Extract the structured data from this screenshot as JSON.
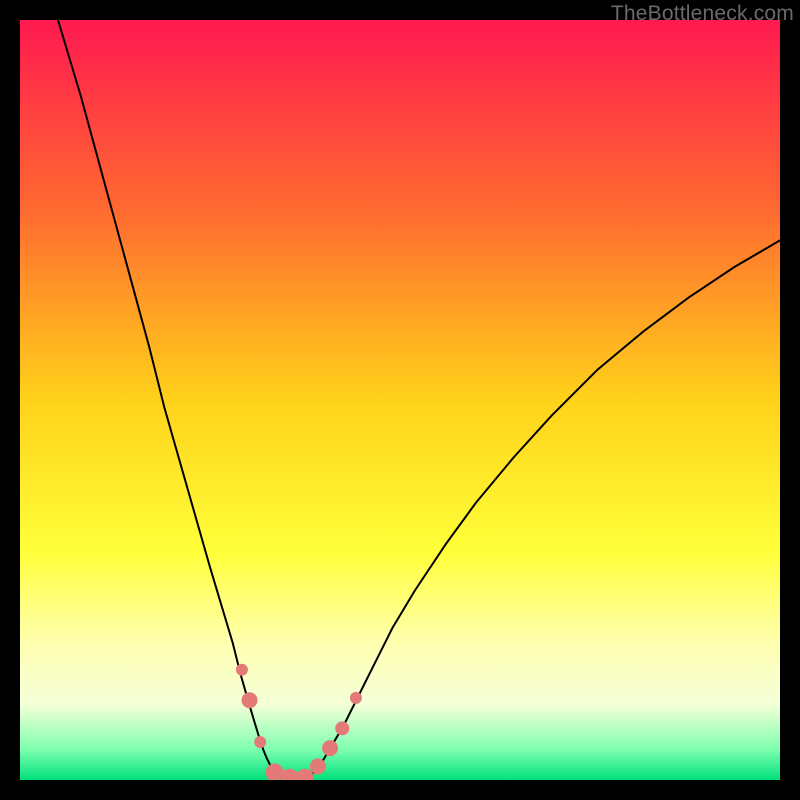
{
  "watermark": "TheBottleneck.com",
  "chart_data": {
    "type": "line",
    "title": "",
    "xlabel": "",
    "ylabel": "",
    "xlim": [
      0,
      100
    ],
    "ylim": [
      0,
      100
    ],
    "background_gradient": {
      "stops": [
        {
          "offset": 0,
          "color": "#ff1950"
        },
        {
          "offset": 25,
          "color": "#ff6a30"
        },
        {
          "offset": 50,
          "color": "#ffd21a"
        },
        {
          "offset": 70,
          "color": "#ffff3a"
        },
        {
          "offset": 82,
          "color": "#ffffb0"
        },
        {
          "offset": 90,
          "color": "#f5ffd8"
        },
        {
          "offset": 96,
          "color": "#7dffb0"
        },
        {
          "offset": 100,
          "color": "#00e07a"
        }
      ]
    },
    "series": [
      {
        "name": "left-curve",
        "color": "#000000",
        "x": [
          5,
          8,
          11,
          14,
          17,
          19,
          21,
          23,
          25,
          26.5,
          28,
          29,
          30,
          30.8,
          31.5,
          32,
          32.5,
          33,
          33.5,
          34
        ],
        "y": [
          100,
          90,
          79,
          68,
          57,
          49,
          42,
          35,
          28,
          23,
          18,
          14,
          10.5,
          7.8,
          5.5,
          4,
          2.8,
          1.8,
          1,
          0.3
        ]
      },
      {
        "name": "right-curve",
        "color": "#000000",
        "x": [
          38,
          39,
          40,
          41,
          42.5,
          44,
          46,
          49,
          52,
          56,
          60,
          65,
          70,
          76,
          82,
          88,
          94,
          100
        ],
        "y": [
          0.3,
          1.4,
          2.8,
          4.5,
          7,
          10,
          14,
          20,
          25,
          31,
          36.5,
          42.5,
          48,
          54,
          59,
          63.5,
          67.5,
          71
        ]
      },
      {
        "name": "valley-floor",
        "color": "#000000",
        "x": [
          34,
          35,
          36,
          37,
          38
        ],
        "y": [
          0.3,
          0.1,
          0.1,
          0.1,
          0.3
        ]
      }
    ],
    "markers": [
      {
        "x": 29.2,
        "y": 14.5,
        "r": 6,
        "color": "#e37a78"
      },
      {
        "x": 30.2,
        "y": 10.5,
        "r": 8,
        "color": "#e37a78"
      },
      {
        "x": 31.6,
        "y": 5.0,
        "r": 6,
        "color": "#e37a78"
      },
      {
        "x": 33.5,
        "y": 1.0,
        "r": 9,
        "color": "#e37a78"
      },
      {
        "x": 35.5,
        "y": 0.3,
        "r": 9,
        "color": "#e37a78"
      },
      {
        "x": 37.5,
        "y": 0.3,
        "r": 9,
        "color": "#e37a78"
      },
      {
        "x": 39.2,
        "y": 1.8,
        "r": 8,
        "color": "#e37a78"
      },
      {
        "x": 40.8,
        "y": 4.2,
        "r": 8,
        "color": "#e37a78"
      },
      {
        "x": 42.4,
        "y": 6.8,
        "r": 7,
        "color": "#e37a78"
      },
      {
        "x": 44.2,
        "y": 10.8,
        "r": 6,
        "color": "#e37a78"
      }
    ]
  }
}
